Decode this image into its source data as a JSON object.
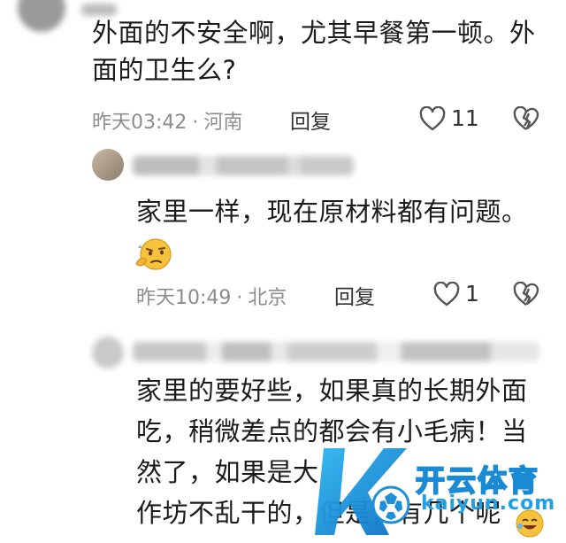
{
  "comments": [
    {
      "text_lines": [
        "外面的不安全啊，尤其早餐第一顿。外",
        "面的卫生么?"
      ],
      "time": "昨天03:42",
      "location": "河南",
      "reply_label": "回复",
      "likes": "11"
    },
    {
      "text": "家里一样，现在原材料都有问题。",
      "time": "昨天10:49",
      "location": "北京",
      "reply_label": "回复",
      "likes": "1"
    },
    {
      "text_lines": [
        "家里的要好些，如果真的长期外面",
        "吃，稍微差点的都会有小毛病！当",
        "然了，如果是大",
        "作坊不乱干的，但是，有几个呢"
      ]
    }
  ],
  "meta_separator": "·",
  "watermark": {
    "brand_cn": "开云体育",
    "brand_en": "kaiyun.com"
  },
  "colors": {
    "brand_blue": "#1fa0e6",
    "meta_gray": "#8c8c8c",
    "icon_gray": "#555555"
  }
}
